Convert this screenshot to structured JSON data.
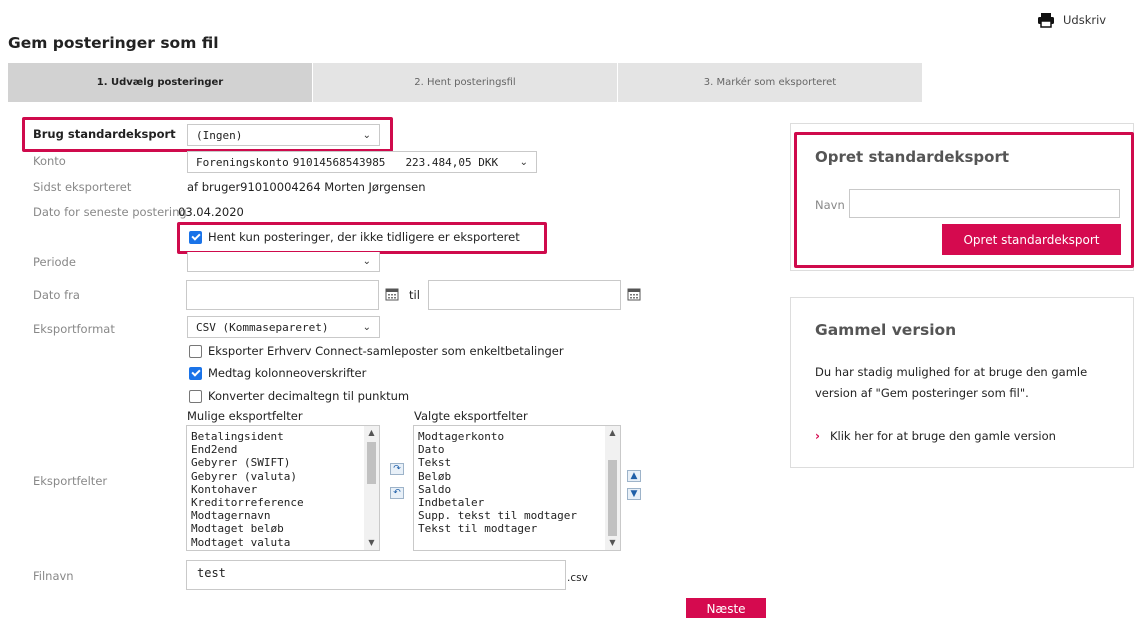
{
  "header": {
    "print_label": "Udskriv",
    "print_icon": "printer-icon",
    "title": "Gem posteringer som fil"
  },
  "steps": [
    {
      "label": "1. Udvælg posteringer",
      "active": true
    },
    {
      "label": "2. Hent posteringsfil",
      "active": false
    },
    {
      "label": "3. Markér som eksporteret",
      "active": false
    }
  ],
  "form": {
    "standard_export": {
      "label": "Brug standardeksport",
      "value": "(Ingen)"
    },
    "account": {
      "label": "Konto",
      "name": "Foreningskonto",
      "number": "91014568543985",
      "balance": "223.484,05 DKK"
    },
    "last_exported": {
      "label": "Sidst eksporteret",
      "value": "af bruger91010004264 Morten Jørgensen"
    },
    "latest_posting_date": {
      "label": "Dato for seneste postering",
      "value": "03.04.2020"
    },
    "only_unexported": {
      "label": "Hent kun posteringer, der ikke tidligere er eksporteret",
      "checked": true
    },
    "period": {
      "label": "Periode",
      "value": ""
    },
    "date_from": {
      "label": "Dato fra",
      "value": "",
      "to_label": "til",
      "to_value": ""
    },
    "export_format": {
      "label": "Eksportformat",
      "value": "CSV (Kommasepareret)"
    },
    "options": [
      {
        "label": "Eksporter Erhverv Connect-samleposter som enkeltbetalinger",
        "checked": false
      },
      {
        "label": "Medtag kolonneoverskrifter",
        "checked": true
      },
      {
        "label": "Konverter decimaltegn til punktum",
        "checked": false
      }
    ],
    "export_fields": {
      "label": "Eksportfelter",
      "available_label": "Mulige eksportfelter",
      "available": [
        "Betalingsident",
        "End2end",
        "Gebyrer (SWIFT)",
        "Gebyrer (valuta)",
        "Kontohaver",
        "Kreditorreference",
        "Modtagernavn",
        "Modtaget beløb",
        "Modtaget valuta"
      ],
      "selected_label": "Valgte eksportfelter",
      "selected": [
        "Modtagerkonto",
        "Dato",
        "Tekst",
        "Beløb",
        "Saldo",
        "Indbetaler",
        "Supp. tekst til modtager",
        "Tekst til modtager"
      ]
    },
    "filename": {
      "label": "Filnavn",
      "value": "test",
      "suffix": ".csv"
    },
    "next_button": "Næste"
  },
  "create_standard": {
    "title": "Opret standardeksport",
    "name_label": "Navn",
    "name_value": "",
    "button": "Opret standardeksport"
  },
  "old_version": {
    "title": "Gammel version",
    "text": "Du har stadig mulighed for at bruge den gamle version af \"Gem posteringer som fil\".",
    "link": "Klik her for at bruge den gamle version"
  },
  "colors": {
    "accent": "#d50a4f",
    "highlight": "#cf0a4c",
    "checkbox": "#1a73e8"
  }
}
